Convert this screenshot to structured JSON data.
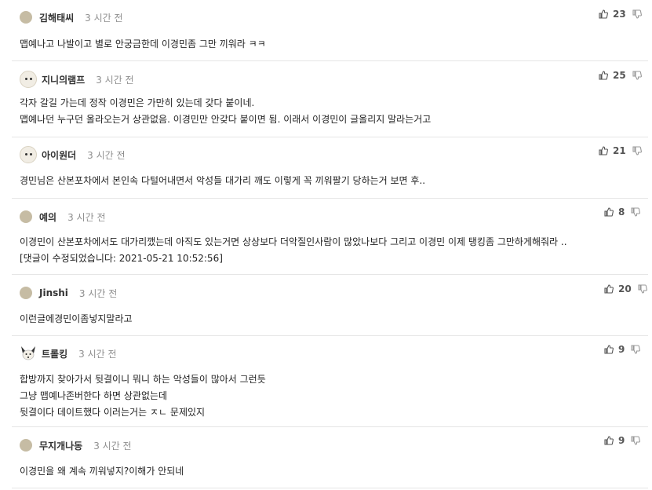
{
  "comments": [
    {
      "nickname": "김해태씨",
      "time": "3 시간 전",
      "likes": "23",
      "avatar": "dot",
      "lines": [
        "맵예나고 나발이고 별로 안궁금한데 이경민좀 그만 끼워라 ㅋㅋ"
      ]
    },
    {
      "nickname": "지니의램프",
      "time": "3 시간 전",
      "likes": "25",
      "avatar": "dog",
      "lines": [
        "각자 갈길 가는데 정작 이경민은 가만히 있는데 갖다 붙이네.",
        "맵예나던 누구던 올라오는거 상관없음. 이경민만 안갖다 붙이면 됨. 이래서 이경민이 글올리지 말라는거고"
      ]
    },
    {
      "nickname": "아이원더",
      "time": "3 시간 전",
      "likes": "21",
      "avatar": "dog",
      "lines": [
        "경민님은 산본포차에서 본인속 다털어내면서 악성들 대가리 깨도 이렇게 꼭 끼워팔기 당하는거 보면 후.."
      ]
    },
    {
      "nickname": "예의",
      "time": "3 시간 전",
      "likes": "8",
      "avatar": "dot",
      "lines": [
        "이경민이 산본포차에서도 대가리깼는데 아직도 있는거면 상상보다 더악질인사람이 많았나보다 그리고 이경민 이제 탱킹좀 그만하게해줘라 ..",
        "[댓글이 수정되었습니다: 2021-05-21 10:52:56]"
      ]
    },
    {
      "nickname": "Jinshi",
      "time": "3 시간 전",
      "likes": "20",
      "avatar": "dot",
      "lines": [
        "이런글에경민이좀넣지말라고"
      ]
    },
    {
      "nickname": "트롤킹",
      "time": "3 시간 전",
      "likes": "9",
      "avatar": "fox",
      "lines": [
        "합방까지 찾아가서 뒷결이니 뭐니 하는 악성들이 많아서 그런듯",
        "그냥 맵예나존버한다 하면 상관없는데",
        "뒷결이다 데이트했다 이러는거는 ㅈㄴ 문제있지"
      ]
    },
    {
      "nickname": "무지개나동",
      "time": "3 시간 전",
      "likes": "9",
      "avatar": "dot",
      "lines": [
        "이경민을 왜 계속 끼워넣지?이해가 안되네"
      ]
    }
  ],
  "icons": {
    "like": "thumbs-up-icon",
    "dislike": "thumbs-down-icon"
  },
  "colors": {
    "avatar_dot": "#c6bca4",
    "divider": "#e6e6e6",
    "time": "#8f8f8f"
  }
}
